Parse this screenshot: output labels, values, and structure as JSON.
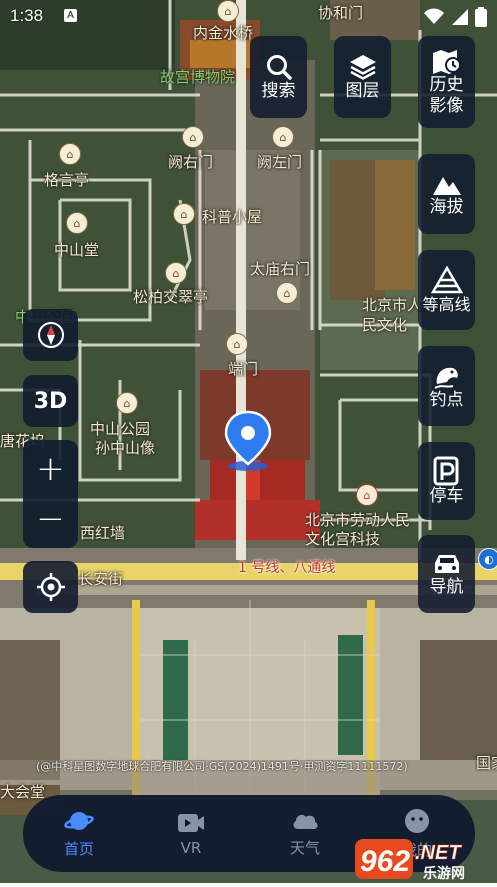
{
  "status": {
    "time": "1:38",
    "app_badge": "A"
  },
  "map": {
    "labels": {
      "neijinshuiqiao": "内金水桥",
      "xiehemen": "协和门",
      "gugongbowuyuan": "故宫博物院",
      "queyoumen": "阙右门",
      "quezuomen": "阙左门",
      "gejinting": "格言亭",
      "kepuxiaowu": "科普小屋",
      "zhongshantang": "中山堂",
      "taimiaoyoumen": "太庙右门",
      "songbaijiaocuiting": "松柏交翠亭",
      "beijingshirenmin": "北京市人民文化",
      "duanmen": "端门",
      "zhongshangongyuan": "中山公园",
      "sunzhongshanxiang": "孙中山像",
      "zhongshanyuan": "中山公园",
      "tanghuawu": "唐花坞",
      "xihongqiang": "西红墙",
      "laodongrenmin": "北京市劳动人民文化宫科技",
      "changanjie": "长安街",
      "metro_line": "1 号线、八通线",
      "dahuitang": "大会堂",
      "east_label": "国家"
    },
    "credit": "(@中科星图数字地球合肥有限公司·GS(2024)1491号·甲测资字11111572)"
  },
  "top_buttons": {
    "search": "搜索",
    "layers": "图层",
    "history": "历史影像"
  },
  "right_buttons": {
    "altitude": "海拔",
    "contour": "等高线",
    "fishing": "钓点",
    "parking": "停车",
    "navigation": "导航"
  },
  "left_controls": {
    "three_d": "3D",
    "zoom_in": "+",
    "zoom_out": "−"
  },
  "bottom_nav": {
    "home": "首页",
    "vr": "VR",
    "weather": "天气",
    "mine": "我的",
    "active_color": "#4a8cff"
  },
  "watermark": {
    "brand": "962.NET",
    "sub": "乐游网"
  }
}
